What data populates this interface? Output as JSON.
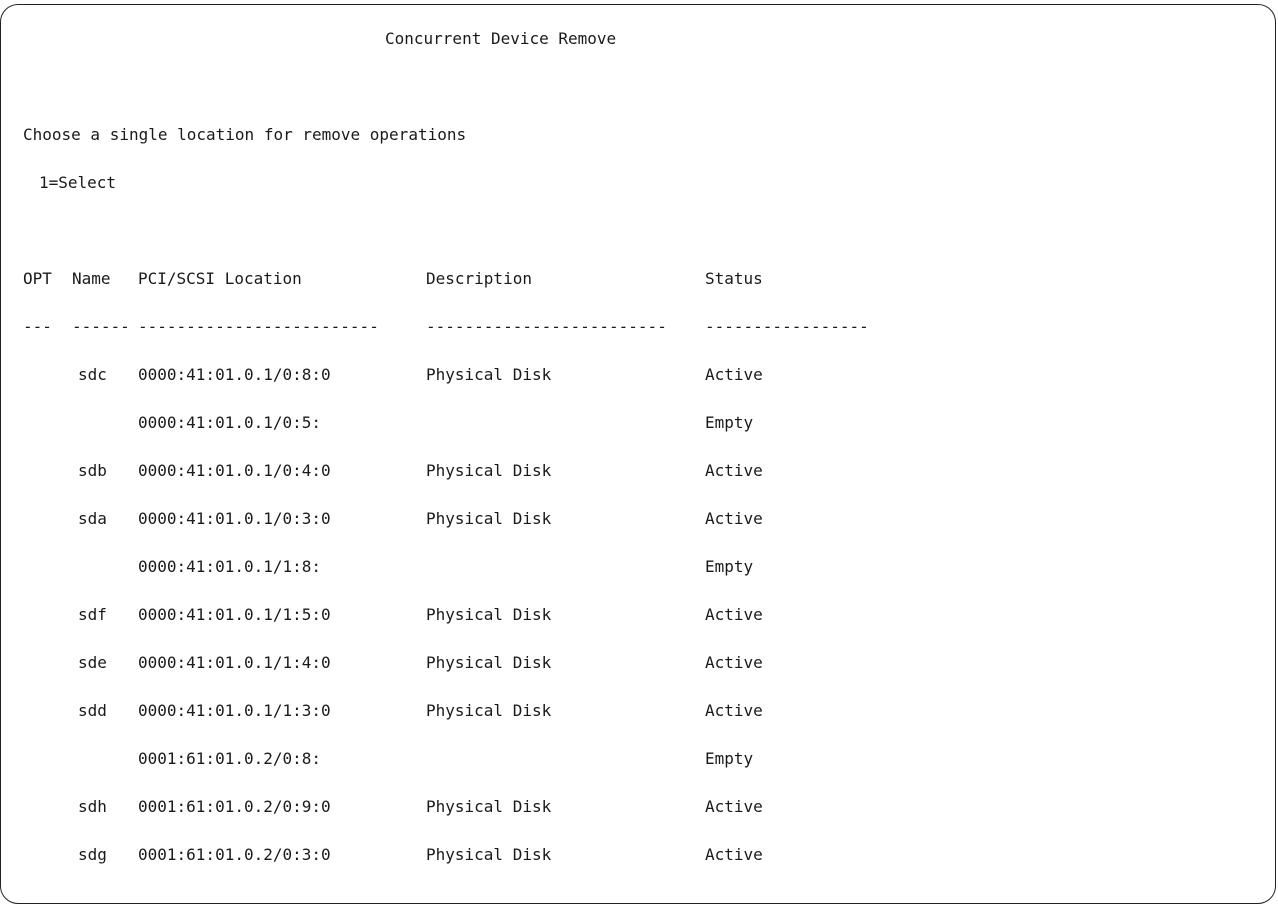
{
  "screen": {
    "title": "Concurrent Device Remove",
    "instruction": "Choose a single location for remove operations",
    "legend": "1=Select"
  },
  "table": {
    "headers": {
      "opt": "OPT",
      "name": "Name",
      "location": "PCI/SCSI Location",
      "description": "Description",
      "status": "Status"
    },
    "separators": {
      "opt": "---",
      "name": "------",
      "location": "-------------------------",
      "description": "-------------------------",
      "status": "-----------------"
    },
    "rows": [
      {
        "opt": "",
        "name": "sdc",
        "location": "0000:41:01.0.1/0:8:0",
        "description": "Physical Disk",
        "status": "Active"
      },
      {
        "opt": "",
        "name": "",
        "location": "0000:41:01.0.1/0:5:",
        "description": "",
        "status": "Empty"
      },
      {
        "opt": "",
        "name": "sdb",
        "location": "0000:41:01.0.1/0:4:0",
        "description": "Physical Disk",
        "status": "Active"
      },
      {
        "opt": "",
        "name": "sda",
        "location": "0000:41:01.0.1/0:3:0",
        "description": "Physical Disk",
        "status": "Active"
      },
      {
        "opt": "",
        "name": "",
        "location": "0000:41:01.0.1/1:8:",
        "description": "",
        "status": "Empty"
      },
      {
        "opt": "",
        "name": "sdf",
        "location": "0000:41:01.0.1/1:5:0",
        "description": "Physical Disk",
        "status": "Active"
      },
      {
        "opt": "",
        "name": "sde",
        "location": "0000:41:01.0.1/1:4:0",
        "description": "Physical Disk",
        "status": "Active"
      },
      {
        "opt": "",
        "name": "sdd",
        "location": "0000:41:01.0.1/1:3:0",
        "description": "Physical Disk",
        "status": "Active"
      },
      {
        "opt": "",
        "name": "",
        "location": "0001:61:01.0.2/0:8:",
        "description": "",
        "status": "Empty"
      },
      {
        "opt": "",
        "name": "sdh",
        "location": "0001:61:01.0.2/0:9:0",
        "description": "Physical Disk",
        "status": "Active"
      },
      {
        "opt": "",
        "name": "sdg",
        "location": "0001:61:01.0.2/0:3:0",
        "description": "Physical Disk",
        "status": "Active"
      }
    ]
  }
}
